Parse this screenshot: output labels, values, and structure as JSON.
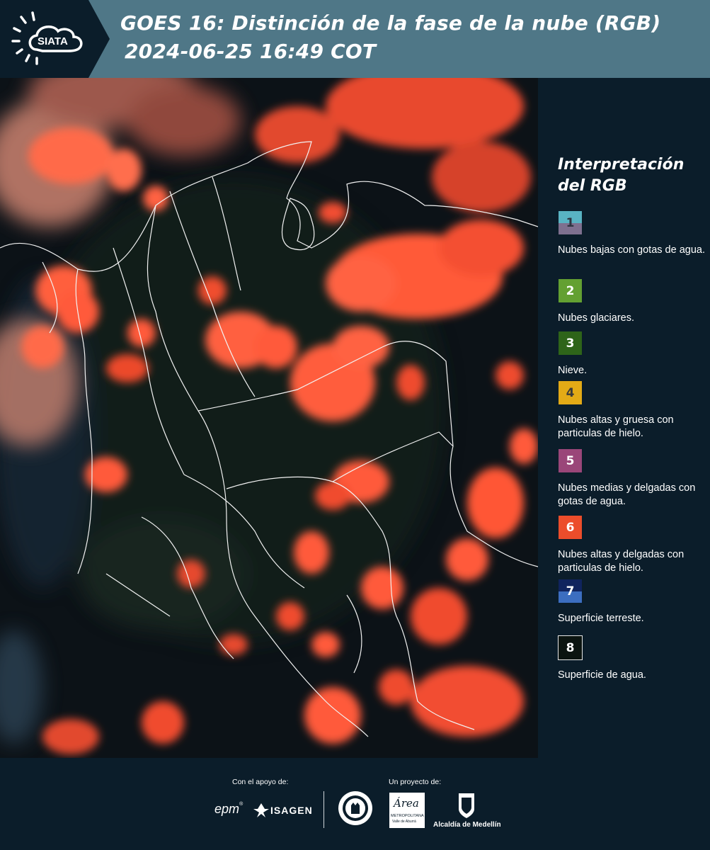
{
  "header": {
    "logo_text": "SIATA",
    "title_line1": "GOES 16: Distinción de la fase de la nube (RGB)",
    "title_line2": "2024-06-25 16:49 COT",
    "bg_color": "#4f7787"
  },
  "legend": {
    "title_line1": "Interpretación",
    "title_line2": "del RGB",
    "items": [
      {
        "number": "1",
        "description": "Nubes bajas con gotas de agua.",
        "color_top": "#59b3c3",
        "color_bottom": "#7e708f",
        "text_color": "#2e3440"
      },
      {
        "number": "2",
        "description": "Nubes glaciares.",
        "color_top": "#63a032",
        "color_bottom": "#63a032",
        "text_color": "#ffffff"
      },
      {
        "number": "3",
        "description": "Nieve.",
        "color_top": "#2e6419",
        "color_bottom": "#2e6419",
        "text_color": "#ffffff"
      },
      {
        "number": "4",
        "description": "Nubes altas y gruesa con particulas de hielo.",
        "color_top": "#e3aa16",
        "color_bottom": "#e3aa16",
        "text_color": "#3a3a3a"
      },
      {
        "number": "5",
        "description": "Nubes medias y delgadas con gotas de agua.",
        "color_top": "#9a4679",
        "color_bottom": "#9a4679",
        "text_color": "#ffffff"
      },
      {
        "number": "6",
        "description": "Nubes altas y delgadas con particulas de hielo.",
        "color_top": "#ec4d2b",
        "color_bottom": "#ec4d2b",
        "text_color": "#ffffff"
      },
      {
        "number": "7",
        "description": "Superficie terreste.",
        "color_top": "#10245e",
        "color_bottom": "#3c6ec0",
        "text_color": "#ffffff"
      },
      {
        "number": "8",
        "description": "Superficie de agua.",
        "color_top": "#0b1410",
        "color_bottom": "#0b1410",
        "text_color": "#ffffff"
      }
    ]
  },
  "footer": {
    "support_label": "Con el apoyo de:",
    "project_label": "Un proyecto de:",
    "epm_text": "epm",
    "isagen_text": "ISAGEN",
    "area_text": "Área",
    "area_sub": "METROPOLITANA",
    "area_sub2": "Valle de Aburrá",
    "alcaldia_text": "Alcaldía de Medellín"
  }
}
